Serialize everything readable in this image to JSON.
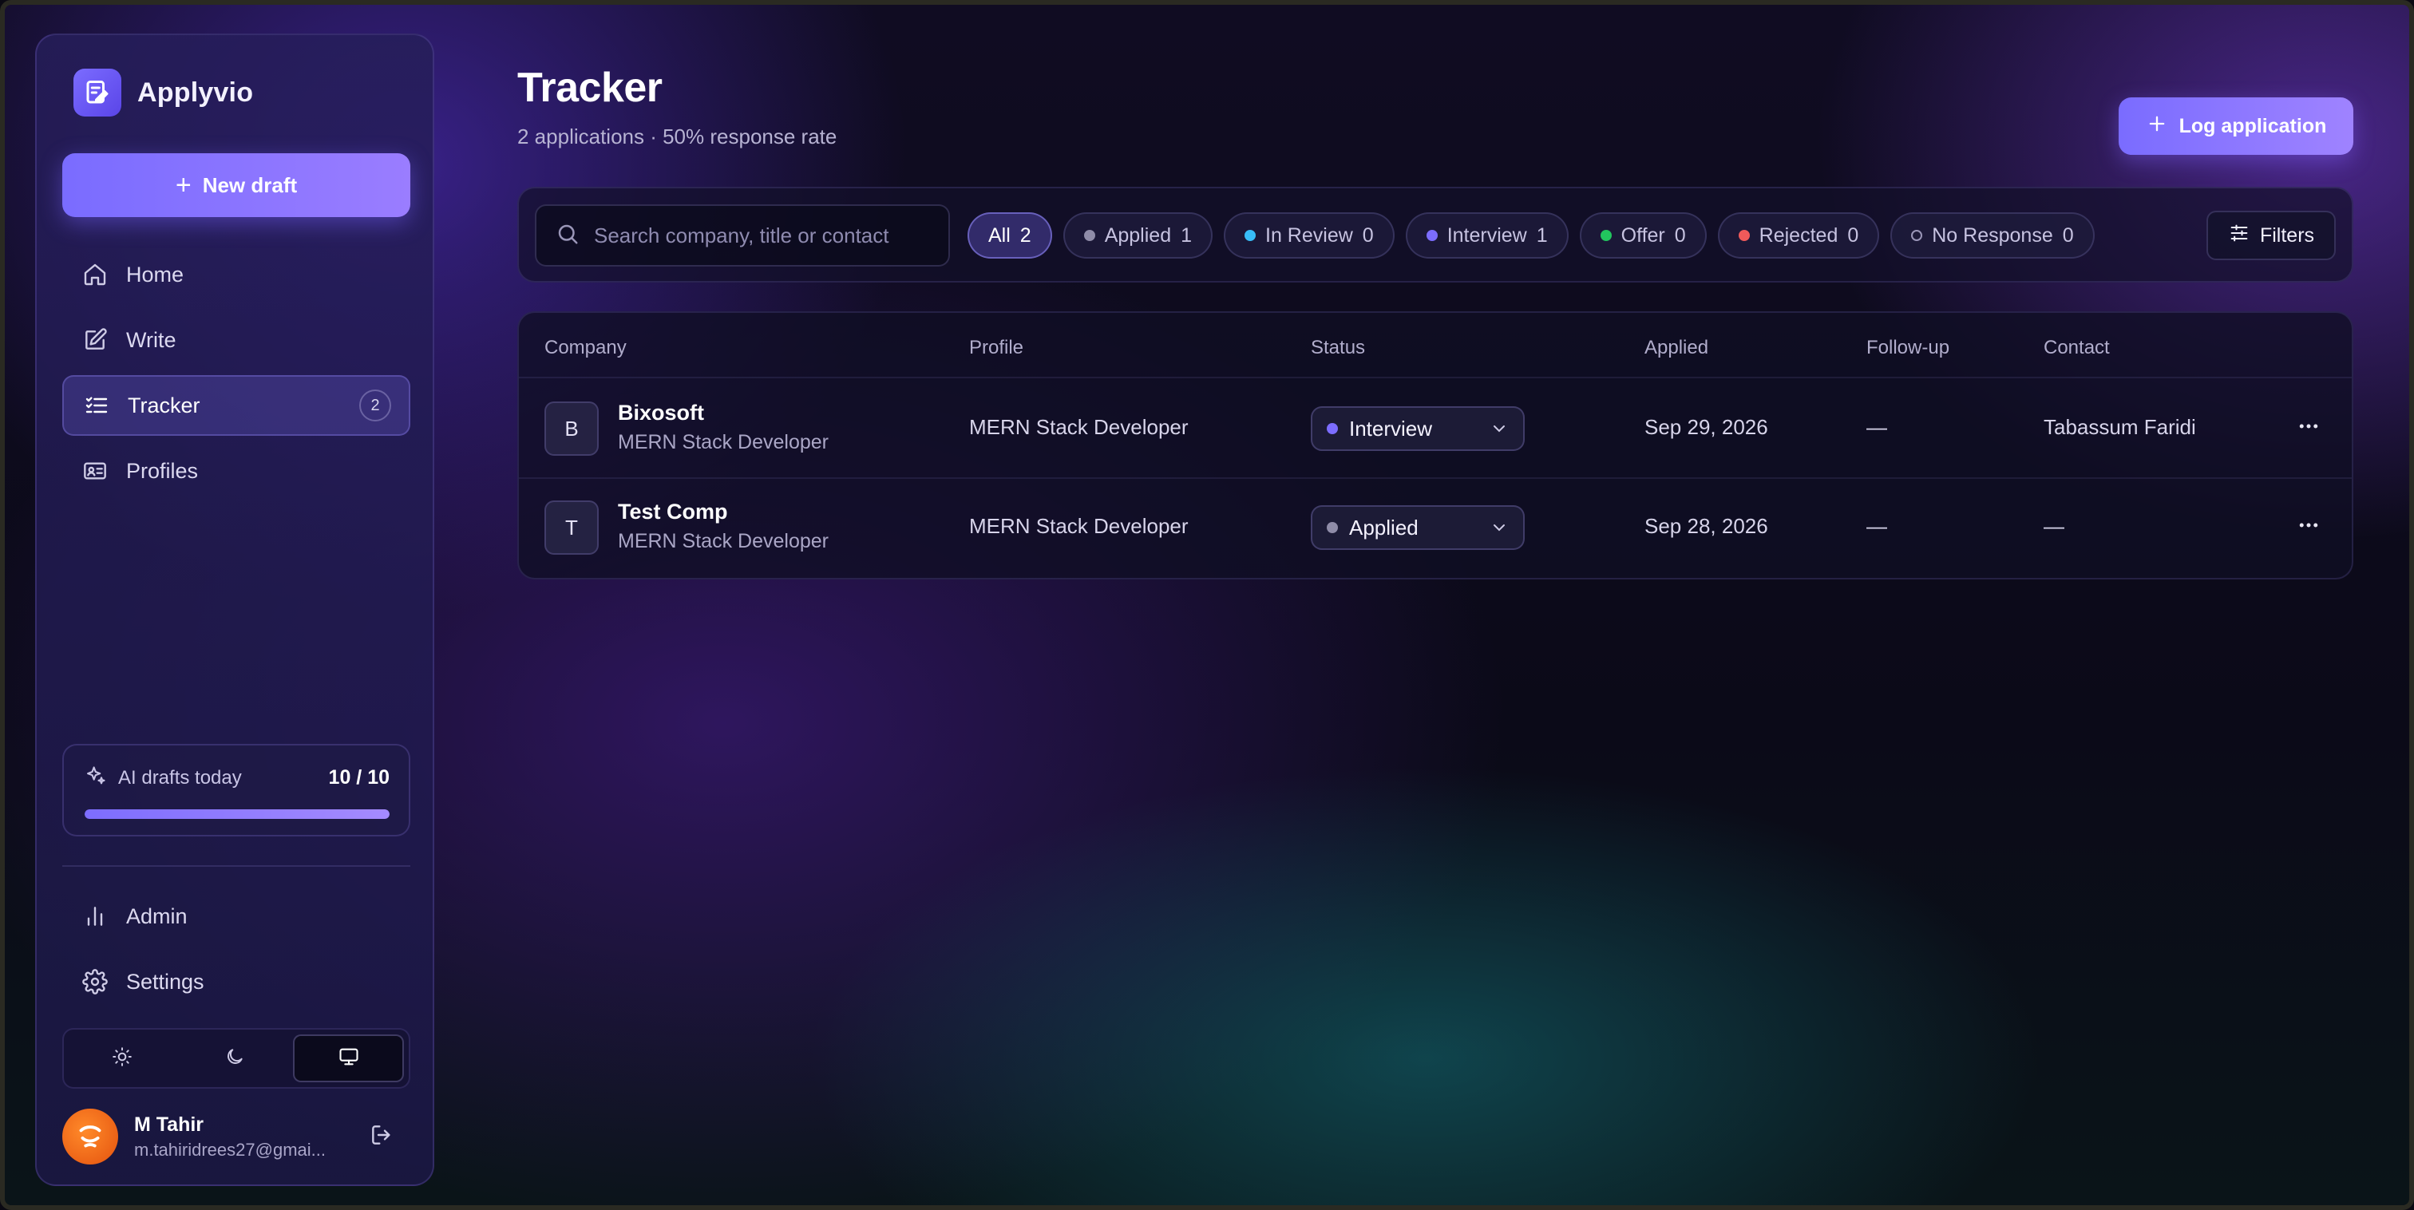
{
  "app": {
    "name": "Applyvio"
  },
  "sidebar": {
    "new_draft_label": "New draft",
    "nav": [
      {
        "label": "Home",
        "icon": "home-icon"
      },
      {
        "label": "Write",
        "icon": "edit-icon"
      },
      {
        "label": "Tracker",
        "icon": "tracker-icon",
        "badge": "2",
        "active": true
      },
      {
        "label": "Profiles",
        "icon": "id-card-icon"
      }
    ],
    "ai_drafts": {
      "label": "AI drafts today",
      "count": "10 / 10",
      "progress": 1.0
    },
    "nav_bottom": [
      {
        "label": "Admin",
        "icon": "bar-chart-icon"
      },
      {
        "label": "Settings",
        "icon": "gear-icon"
      }
    ],
    "theme": {
      "options": [
        "light",
        "dark",
        "system"
      ],
      "selected": "system"
    },
    "user": {
      "name": "M Tahir",
      "email": "m.tahiridrees27@gmai..."
    }
  },
  "page": {
    "title": "Tracker",
    "subtitle": "2 applications · 50% response rate",
    "log_button_label": "Log application"
  },
  "filterbar": {
    "search_placeholder": "Search company, title or contact",
    "chips": [
      {
        "label": "All",
        "count": "2",
        "active": true,
        "color": ""
      },
      {
        "label": "Applied",
        "count": "1",
        "color": "#8f8ca8"
      },
      {
        "label": "In Review",
        "count": "0",
        "color": "#38bdf8"
      },
      {
        "label": "Interview",
        "count": "1",
        "color": "#7c6dff"
      },
      {
        "label": "Offer",
        "count": "0",
        "color": "#22c55e"
      },
      {
        "label": "Rejected",
        "count": "0",
        "color": "#f05a5a"
      },
      {
        "label": "No Response",
        "count": "0",
        "color": "hollow"
      }
    ],
    "filters_label": "Filters"
  },
  "table": {
    "headers": [
      "Company",
      "Profile",
      "Status",
      "Applied",
      "Follow-up",
      "Contact"
    ],
    "rows": [
      {
        "initial": "B",
        "company": "Bixosoft",
        "title": "MERN Stack Developer",
        "profile": "MERN Stack Developer",
        "status": "Interview",
        "status_color": "#7c6dff",
        "applied": "Sep 29, 2026",
        "followup": "—",
        "contact": "Tabassum Faridi"
      },
      {
        "initial": "T",
        "company": "Test Comp",
        "title": "MERN Stack Developer",
        "profile": "MERN Stack Developer",
        "status": "Applied",
        "status_color": "#8f8ca8",
        "applied": "Sep 28, 2026",
        "followup": "—",
        "contact": "—"
      }
    ]
  }
}
